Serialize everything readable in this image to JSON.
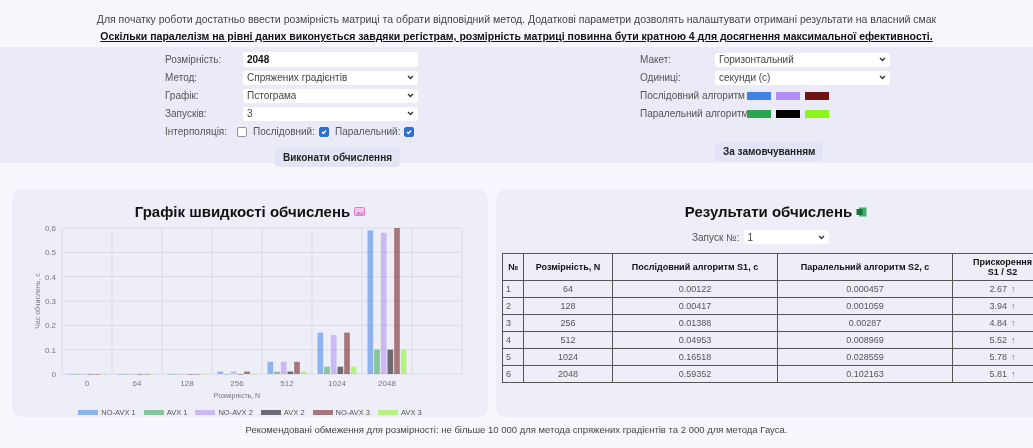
{
  "intro": "Для початку роботи достатньо ввести розмірність матриці та обрати відповідний метод. Додаткові параметри дозволять налаштувати отримані результати на власний смак",
  "notice": "Оскільки паралелізм на рівні даних виконується завдяки регістрам, розмірність матриці повинна бути кратною 4 для досягнення максимальної ефективності.",
  "settings": {
    "left": [
      {
        "kind": "input",
        "label": "Розмірність:",
        "value": "2048"
      },
      {
        "kind": "select",
        "label": "Метод:",
        "value": "Спряжених градієнтів"
      },
      {
        "kind": "select",
        "label": "Графік:",
        "value": "Пстограма"
      },
      {
        "kind": "select",
        "label": "Запусків:",
        "value": "3"
      }
    ],
    "interpolation": {
      "label": "Інтерполяція:",
      "options": [
        {
          "checked": false
        },
        {
          "label": "Послідовний:",
          "checked": true
        },
        {
          "label": "Паралельний:",
          "checked": true
        }
      ]
    },
    "run_button": "Виконати обчислення",
    "right": [
      {
        "kind": "select",
        "label": "Макет:",
        "value": "Горизонтальний"
      },
      {
        "kind": "select",
        "label": "Одиниці:",
        "value": "секунди (с)"
      },
      {
        "kind": "swatches",
        "label": "Послідовний алгоритм",
        "colors": [
          {
            "color": "#3f84e5"
          },
          {
            "color": "#b08cf5"
          },
          {
            "color": "#6e1414"
          }
        ]
      },
      {
        "kind": "swatches",
        "label": "Паралельний алгоритм",
        "colors": [
          {
            "color": "#2da44e"
          },
          {
            "color": "#000000"
          },
          {
            "color": "#8df51a"
          }
        ]
      }
    ],
    "default_button": "За замовчуванням"
  },
  "chart_card": {
    "title": "Графік швидкості обчислень",
    "chart_data": {
      "type": "bar",
      "grid": true,
      "legend": "bottom",
      "xlabel": "Розмірність, N",
      "ylabel": "Час обчислень, с",
      "categories": [
        "0",
        "64",
        "128",
        "256",
        "512",
        "1024",
        "2048"
      ],
      "ylim": [
        0,
        0.6
      ],
      "yticks": [
        0,
        0.1,
        0.2,
        0.3,
        0.4,
        0.5,
        {
          "value": 0.6,
          "label": "0,6"
        }
      ],
      "series": [
        {
          "name": "NO-AVX 1",
          "color": "#3f84e5",
          "values": [
            0,
            0,
            0,
            0.01,
            0.05,
            0.17,
            0.59
          ]
        },
        {
          "name": "AVX 1",
          "color": "#2da44e",
          "values": [
            0,
            0,
            0,
            0,
            0.01,
            0.03,
            0.1
          ]
        },
        {
          "name": "NO-AVX 2",
          "color": "#b08cf5",
          "values": [
            0,
            0,
            0,
            0.01,
            0.05,
            0.16,
            0.58
          ]
        },
        {
          "name": "AVX 2",
          "color": "#000000",
          "values": [
            0,
            0,
            0,
            0,
            0.01,
            0.03,
            0.1
          ]
        },
        {
          "name": "NO-AVX 3",
          "color": "#6e1414",
          "values": [
            0,
            0,
            0,
            0.01,
            0.05,
            0.17,
            0.6
          ]
        },
        {
          "name": "AVX 3",
          "color": "#8df51a",
          "values": [
            0,
            0,
            0,
            0,
            0.01,
            0.03,
            0.1
          ]
        }
      ]
    }
  },
  "results_card": {
    "title": "Результати обчислень",
    "run_label": "Запуск №:",
    "run_value": "1",
    "columns": [
      {
        "lines": [
          "№"
        ]
      },
      {
        "lines": [
          "Розмірність, N"
        ]
      },
      {
        "lines": [
          "Послідовний алгоритм S1, с"
        ]
      },
      {
        "lines": [
          "Паралельний алгоритм S2, с"
        ]
      },
      {
        "lines": [
          "Прискорення",
          "S1 / S2"
        ]
      }
    ],
    "rows": [
      {
        "cells": [
          "1",
          "64",
          "0.00122",
          "0.000457",
          "2.67"
        ],
        "arrow": "↑"
      },
      {
        "cells": [
          "2",
          "128",
          "0.00417",
          "0.001059",
          "3.94"
        ],
        "arrow": "↑"
      },
      {
        "cells": [
          "3",
          "256",
          "0.01388",
          "0.00287",
          "4.84"
        ],
        "arrow": "↑"
      },
      {
        "cells": [
          "4",
          "512",
          "0.04953",
          "0.008969",
          "5.52"
        ],
        "arrow": "↑"
      },
      {
        "cells": [
          "5",
          "1024",
          "0.16518",
          "0.028559",
          "5.78"
        ],
        "arrow": "↑"
      },
      {
        "cells": [
          "6",
          "2048",
          "0.59352",
          "0.102163",
          "5.81"
        ],
        "arrow": "↑"
      }
    ]
  },
  "footer": "Рекомендовані обмеження для розмірності: не більше 10 000 для метода спряжених градієнтів та 2 000 для метода Гауса."
}
